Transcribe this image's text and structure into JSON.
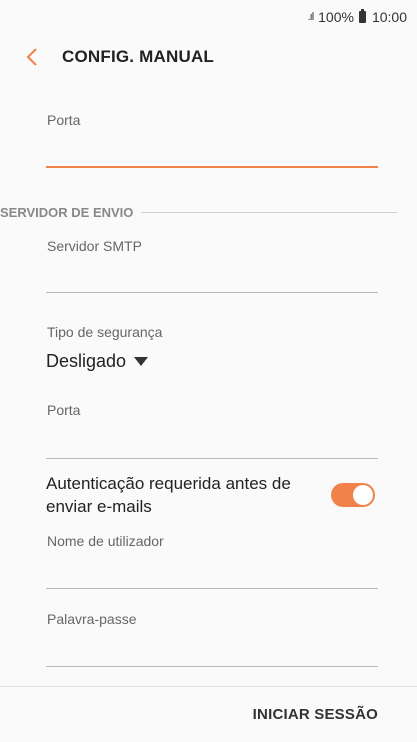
{
  "status_bar": {
    "signal": ".ıl",
    "battery": "100%",
    "time": "10:00"
  },
  "header": {
    "title": "CONFIG. MANUAL"
  },
  "incoming": {
    "port_label": "Porta"
  },
  "outgoing": {
    "section_title": "SERVIDOR DE ENVIO",
    "smtp_label": "Servidor SMTP",
    "security_label": "Tipo de segurança",
    "security_value": "Desligado",
    "port_label": "Porta",
    "auth_label": "Autenticação requerida antes de enviar e-mails",
    "auth_enabled": true,
    "username_label": "Nome de utilizador",
    "password_label": "Palavra-passe"
  },
  "footer": {
    "button_label": "INICIAR SESSÃO"
  },
  "colors": {
    "accent": "#f0824a",
    "background": "#fafafa"
  }
}
